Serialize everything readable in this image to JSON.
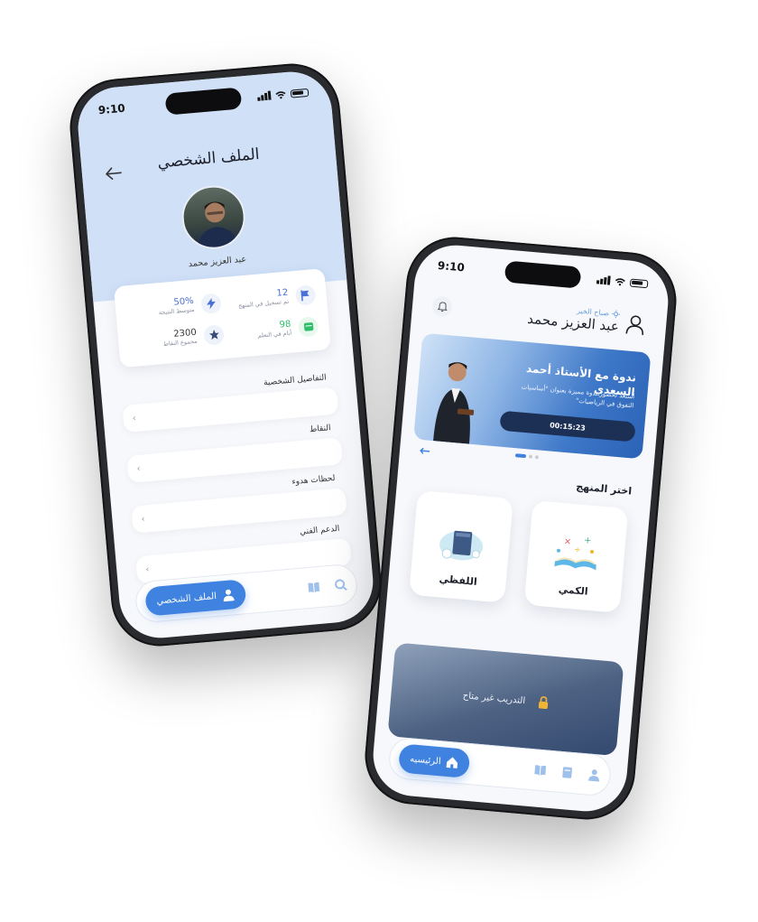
{
  "profile_screen": {
    "status_time": "9:10",
    "title": "الملف الشخصي",
    "user_name": "عبد العزيز محمد",
    "stats": [
      {
        "value": "50%",
        "label": "متوسط النتيجة",
        "icon": "lightning-icon"
      },
      {
        "value": "12",
        "label": "تم تسجيل في المنهج",
        "icon": "flag-icon"
      },
      {
        "value": "2300",
        "label": "مجموع النقاط",
        "icon": "star-icon"
      },
      {
        "value": "98",
        "label": "أيام في التعلم",
        "icon": "calendar-icon"
      }
    ],
    "section_title": "التفاصيل الشخصية",
    "menu": [
      {
        "label": ""
      },
      {
        "label": "النقاط"
      },
      {
        "label": "لحظات هدوء"
      },
      {
        "label": "الدعم الفني"
      }
    ],
    "nav": {
      "active_label": "الملف الشخصي"
    }
  },
  "home_screen": {
    "status_time": "9:10",
    "greeting": "صباح الخير",
    "user_name": "عبد العزيز محمد",
    "banner": {
      "title": "ندوة مع الأستاذ أحمد السعدي",
      "subtitle": "استعد لحضور ندوة مميزة بعنوان \"أساسيات التفوق في الرياضيات\"",
      "countdown": "00:15:23"
    },
    "section_title": "اختر المنهج",
    "courses": [
      {
        "label": "اللفظي"
      },
      {
        "label": "الكمي"
      }
    ],
    "locked_training": "التدريب غير متاح",
    "nav": {
      "active_label": "الرئيسيه"
    },
    "colors": {
      "accent": "#3f82e0",
      "banner_dark": "#1c2f55"
    }
  }
}
